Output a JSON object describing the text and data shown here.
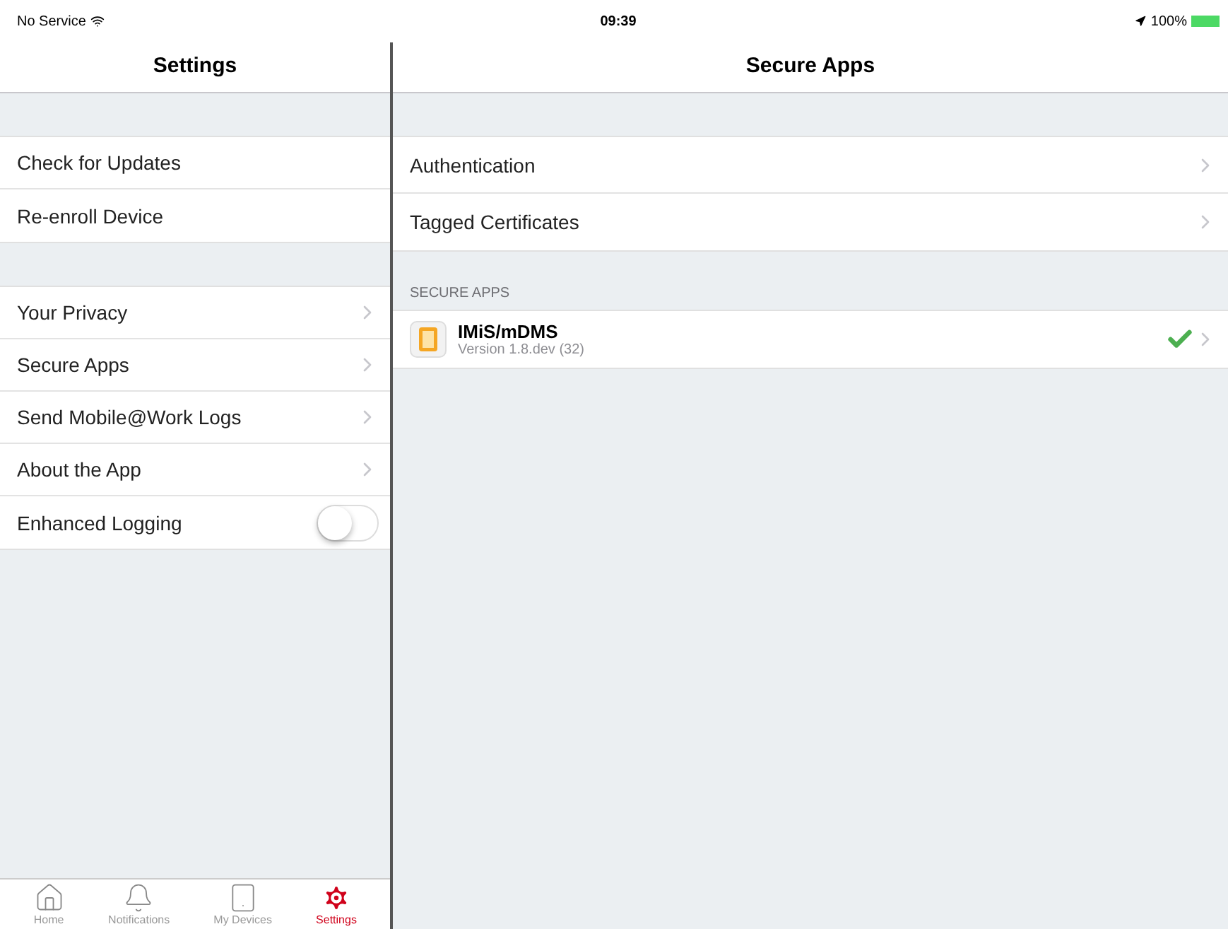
{
  "status_bar": {
    "carrier": "No Service",
    "time": "09:39",
    "battery": "100%"
  },
  "master": {
    "title": "Settings",
    "groups": [
      [
        {
          "label": "Check for Updates",
          "kind": "plain"
        },
        {
          "label": "Re-enroll Device",
          "kind": "plain"
        }
      ],
      [
        {
          "label": "Your Privacy",
          "kind": "disclosure"
        },
        {
          "label": "Secure Apps",
          "kind": "disclosure"
        },
        {
          "label": "Send Mobile@Work Logs",
          "kind": "disclosure"
        },
        {
          "label": "About the App",
          "kind": "disclosure"
        },
        {
          "label": "Enhanced Logging",
          "kind": "switch",
          "on": false
        }
      ]
    ]
  },
  "detail": {
    "title": "Secure Apps",
    "items": [
      {
        "label": "Authentication"
      },
      {
        "label": "Tagged Certificates"
      }
    ],
    "section_header": "SECURE APPS",
    "apps": [
      {
        "name": "IMiS/mDMS",
        "version": "Version 1.8.dev (32)",
        "verified": true
      }
    ]
  },
  "tab_bar": [
    {
      "label": "Home",
      "selected": false
    },
    {
      "label": "Notifications",
      "selected": false
    },
    {
      "label": "My Devices",
      "selected": false
    },
    {
      "label": "Settings",
      "selected": true
    }
  ]
}
